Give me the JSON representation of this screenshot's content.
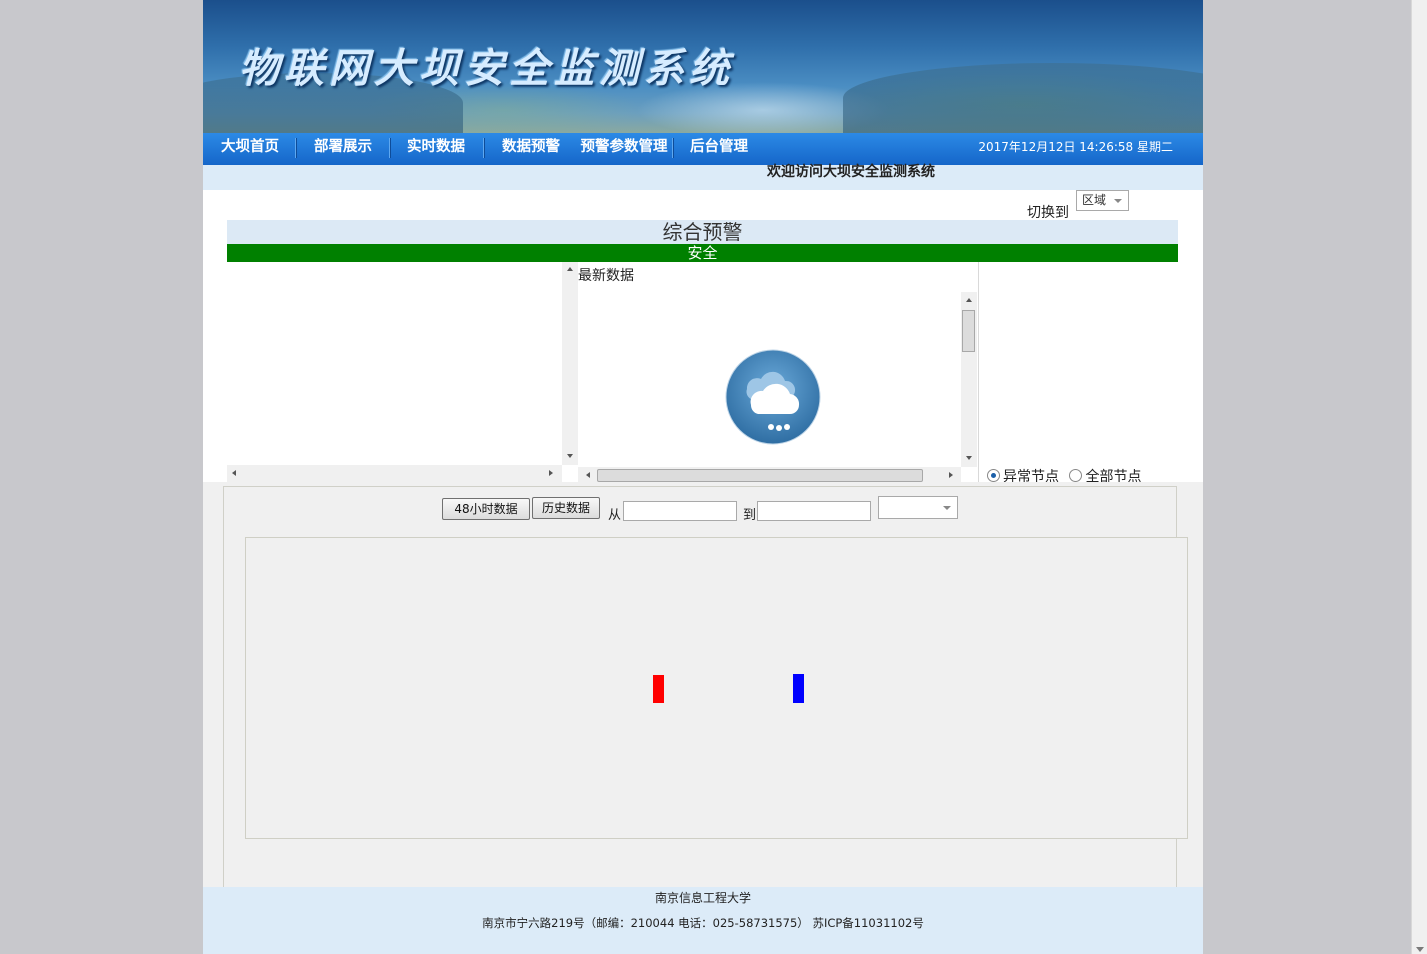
{
  "header": {
    "site_title": "物联网大坝安全监测系统"
  },
  "nav": {
    "items": [
      {
        "label": "大坝首页"
      },
      {
        "label": "部署展示"
      },
      {
        "label": "实时数据"
      },
      {
        "label": "数据预警"
      },
      {
        "label": "预警参数管理"
      },
      {
        "label": "后台管理"
      }
    ],
    "datetime": "2017年12月12日 14:26:58 星期二"
  },
  "welcome": "欢迎访问大坝安全监测系统",
  "switch": {
    "label": "切换到",
    "selected": "区域"
  },
  "warning": {
    "heading": "综合预警",
    "status": "安全",
    "status_color": "#008000"
  },
  "latest": {
    "label": "最新数据",
    "icon": "cloud-rain-icon"
  },
  "node_filter": {
    "options": [
      "异常节点",
      "全部节点"
    ],
    "selected": "异常节点"
  },
  "data_controls": {
    "btn_48h": "48小时数据",
    "btn_history": "历史数据",
    "from_label": "从",
    "to_label": "到",
    "from_value": "",
    "to_value": "",
    "select_value": ""
  },
  "legend_colors": {
    "red": "#ff0000",
    "blue": "#0000ff"
  },
  "footer": {
    "line1": "南京信息工程大学",
    "line2": "南京市宁六路219号（邮编：210044 电话：025-58731575） 苏ICP备11031102号"
  }
}
